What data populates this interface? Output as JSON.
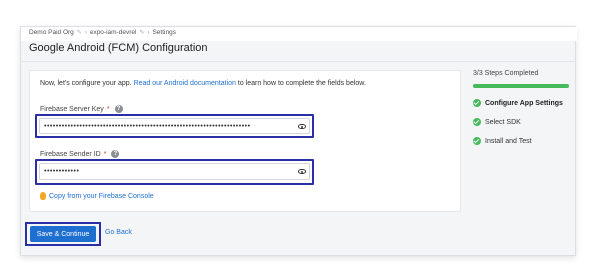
{
  "breadcrumb": {
    "org": "Demo Paid Org",
    "project": "expo-iam-devrel",
    "page": "Settings"
  },
  "page_title": "Google Android (FCM) Configuration",
  "intro": {
    "prefix": "Now, let's configure your app.",
    "link": "Read our Android documentation",
    "suffix": "to learn how to complete the fields below."
  },
  "server_key": {
    "label": "Firebase Server Key",
    "required_mark": "*",
    "value": "••••••••••••••••••••••••••••••••••••••••••••••••••••••••••••••••••••••"
  },
  "sender_id": {
    "label": "Firebase Sender ID",
    "required_mark": "*",
    "value": "••••••••••••"
  },
  "copy_link": "Copy from your Firebase Console",
  "actions": {
    "save_label": "Save & Continue",
    "back_label": "Go Back"
  },
  "steps": {
    "title": "3/3 Steps Completed",
    "progress": 1.0,
    "items": [
      {
        "label": "Configure App Settings",
        "active": true
      },
      {
        "label": "Select SDK",
        "active": false
      },
      {
        "label": "Install and Test",
        "active": false
      }
    ]
  },
  "colors": {
    "link": "#1f6fd1",
    "primary_button": "#1f6fd1",
    "success": "#46b95b",
    "highlight": "#2a2fa8",
    "required": "#d0342c"
  },
  "icons": {
    "edit": "pencil-icon",
    "separator": "chevron-right-icon",
    "help": "question-icon",
    "reveal": "eye-icon",
    "copy": "firebase-icon",
    "step": "check-circle-icon"
  }
}
